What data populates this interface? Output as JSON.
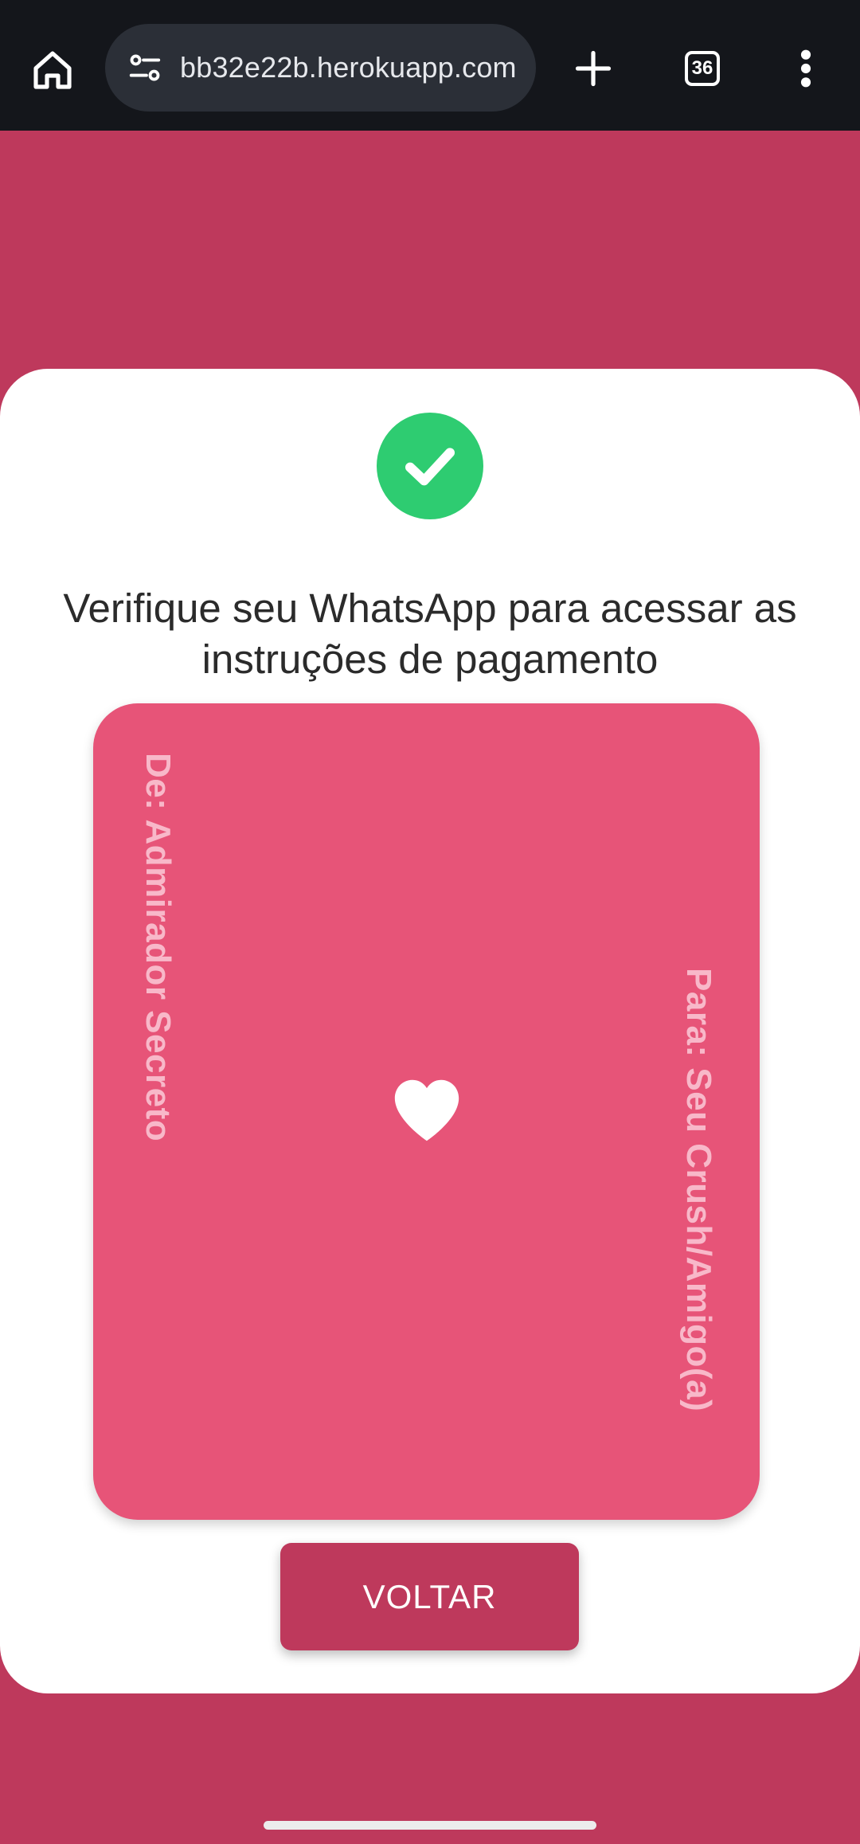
{
  "browser": {
    "url": "bb32e22b.herokuapp.com",
    "tab_count": "36",
    "icons": {
      "home": "home-icon",
      "site_settings": "site-settings-icon",
      "new_tab": "plus-icon",
      "tabs": "tab-switcher-icon",
      "menu": "more-vert-icon"
    }
  },
  "page": {
    "headline": "Verifique seu WhatsApp para acessar as instruções de pagamento",
    "status_icon": "check-circle-icon",
    "card": {
      "from": "De: Admirador Secreto",
      "to": "Para: Seu Crush/Amigo(a)",
      "icon": "heart-icon"
    },
    "back_button": "VOLTAR"
  },
  "colors": {
    "background": "#be395c",
    "card": "#e75478",
    "success": "#2ecc71",
    "toolbar": "#14161b"
  }
}
